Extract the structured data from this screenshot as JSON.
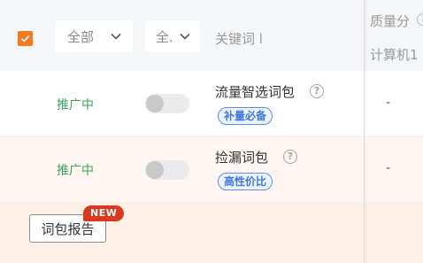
{
  "header": {
    "select_all_checked": true,
    "filter_status": {
      "value": "全部"
    },
    "filter_second": {
      "value": "全."
    },
    "keyword_header": "关键词 l",
    "quality_header": "质量分",
    "device_header": "计算机1",
    "help_glyph": "?"
  },
  "rows": [
    {
      "status": "推广中",
      "toggle_on": false,
      "name": "流量智选词包",
      "tag": "补量必备",
      "value": "-"
    },
    {
      "status": "推广中",
      "toggle_on": false,
      "name": "捡漏词包",
      "tag": "高性价比",
      "value": "-"
    }
  ],
  "footer": {
    "report_button": "词包报告",
    "new_badge": "NEW"
  },
  "colors": {
    "accent": "#f07b23",
    "status_green": "#3aa55d",
    "tag_blue": "#3f78e0",
    "badge_red": "#d9391e"
  },
  "icons": {
    "check": "check-icon",
    "chevron": "chevron-down-icon",
    "help": "help-icon"
  }
}
